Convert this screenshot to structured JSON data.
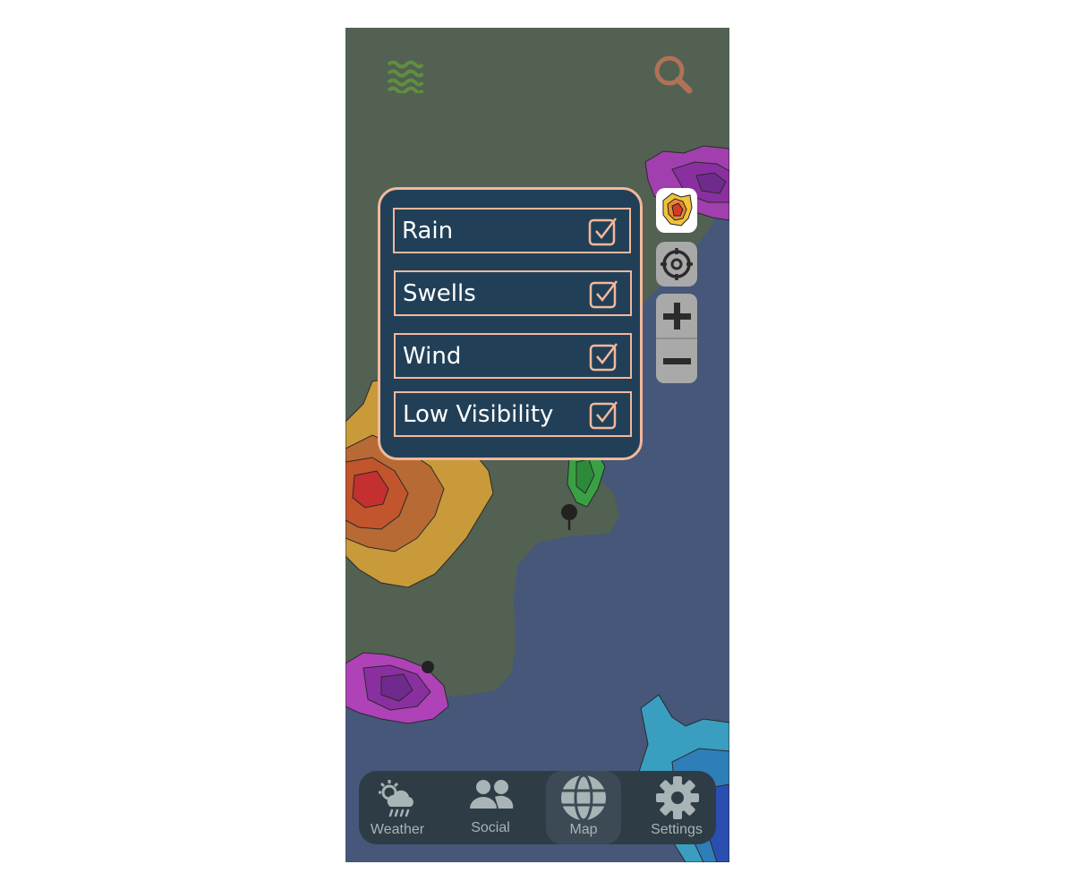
{
  "app": {
    "header": {
      "left_icon": "waves-icon",
      "right_icon": "search-icon"
    },
    "layers_panel": {
      "items": [
        {
          "label": "Rain",
          "checked": true
        },
        {
          "label": "Swells",
          "checked": true
        },
        {
          "label": "Wind",
          "checked": true
        },
        {
          "label": "Low Visibility",
          "checked": true
        }
      ]
    },
    "map_controls": {
      "legend_icon": "weather-legend-icon",
      "locate_icon": "crosshair-icon",
      "zoom_in_icon": "plus-icon",
      "zoom_out_icon": "minus-icon"
    },
    "tabs": [
      {
        "label": "Weather",
        "icon": "weather-icon",
        "active": false
      },
      {
        "label": "Social",
        "icon": "people-icon",
        "active": false
      },
      {
        "label": "Map",
        "icon": "globe-icon",
        "active": true
      },
      {
        "label": "Settings",
        "icon": "gear-icon",
        "active": false
      }
    ],
    "colors": {
      "land": "#526152",
      "water": "#46577a",
      "panel": "#214058",
      "accent": "#f3b89b",
      "tabbar": "#2e3c46",
      "tab_text": "#a8b4b5"
    }
  }
}
